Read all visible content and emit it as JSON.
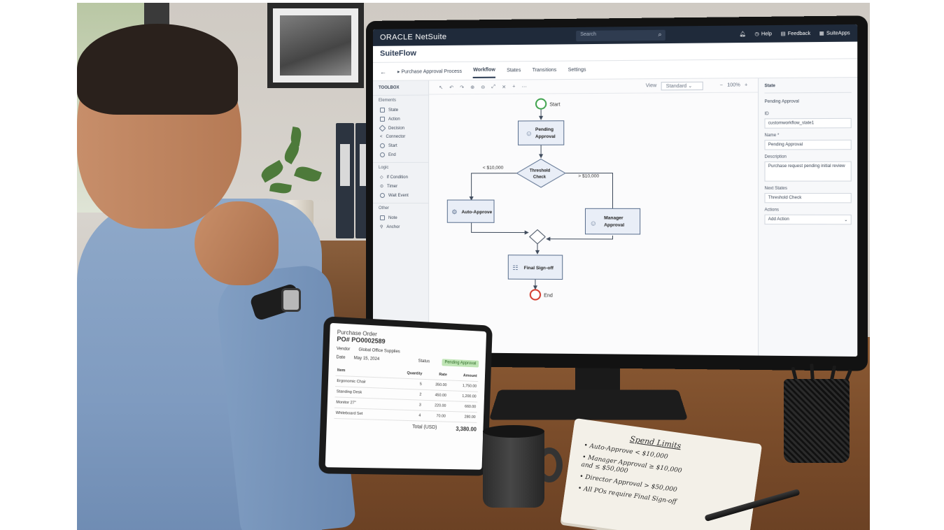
{
  "app": {
    "brand": "ORACLE NetSuite",
    "search_placeholder": "Search",
    "top_links": [
      "Help",
      "Feedback",
      "SuiteApps"
    ],
    "title": "SuiteFlow",
    "breadcrumb": "Purchase Approval Process",
    "tabs": [
      "Workflow",
      "States",
      "Transitions",
      "Settings"
    ],
    "active_tab": "Workflow"
  },
  "toolbox": {
    "heading": "TOOLBOX",
    "sections": [
      {
        "label": "Elements",
        "items": [
          "State",
          "Action",
          "Decision",
          "Connector",
          "Start",
          "End"
        ]
      },
      {
        "label": "Logic",
        "items": [
          "If Condition",
          "Timer",
          "Wait Event"
        ]
      },
      {
        "label": "Other",
        "items": [
          "Note",
          "Anchor"
        ]
      }
    ]
  },
  "canvas": {
    "view_label": "View",
    "view_value": "Standard",
    "zoom": "100%",
    "nodes": {
      "start": "Start",
      "pending": [
        "Pending",
        "Approval"
      ],
      "threshold": [
        "Threshold",
        "Check"
      ],
      "auto": "Auto-Approve",
      "manager": [
        "Manager",
        "Approval"
      ],
      "final": "Final Sign-off",
      "end": "End"
    },
    "edges": {
      "low": "< $10,000",
      "high": "> $10,000"
    }
  },
  "properties": {
    "heading": "State",
    "state_name": "Pending Approval",
    "id_label": "ID",
    "id_value": "customworkflow_state1",
    "name_label": "Name *",
    "name_value": "Pending Approval",
    "description_label": "Description",
    "description_value": "Purchase request pending initial review",
    "next_states_label": "Next States",
    "next_states_value": "Threshold Check",
    "actions_label": "Actions",
    "actions_value": "Add Action"
  },
  "tablet": {
    "title": "Purchase Order",
    "po": "PO# PO0002589",
    "vendor_label": "Vendor",
    "vendor": "Global Office Supplies",
    "date_label": "Date",
    "date": "May 15, 2024",
    "status_label": "Status",
    "status": "Pending Approval",
    "columns": [
      "Item",
      "Quantity",
      "Rate",
      "Amount"
    ],
    "rows": [
      [
        "Ergonomic Chair",
        "5",
        "350.00",
        "1,750.00"
      ],
      [
        "Standing Desk",
        "2",
        "450.00",
        "1,200.00"
      ],
      [
        "Monitor 27\"",
        "3",
        "220.00",
        "660.00"
      ],
      [
        "Whiteboard Set",
        "4",
        "70.00",
        "280.00"
      ]
    ],
    "total_label": "Total (USD)",
    "total": "3,380.00"
  },
  "notebook": {
    "title": "Spend Limits",
    "lines": [
      "• Auto-Approve < $10,000",
      "• Manager Approval ≥ $10,000",
      "  and ≤ $50,000",
      "• Director Approval > $50,000",
      "• All POs require Final Sign-off"
    ]
  },
  "colors": {
    "navbar": "#1f2a3a",
    "node_fill": "#e9eef7",
    "node_stroke": "#5a6f8e",
    "start": "#3fa34d",
    "end": "#d33a2c",
    "status_badge": "#bfe5b5"
  }
}
